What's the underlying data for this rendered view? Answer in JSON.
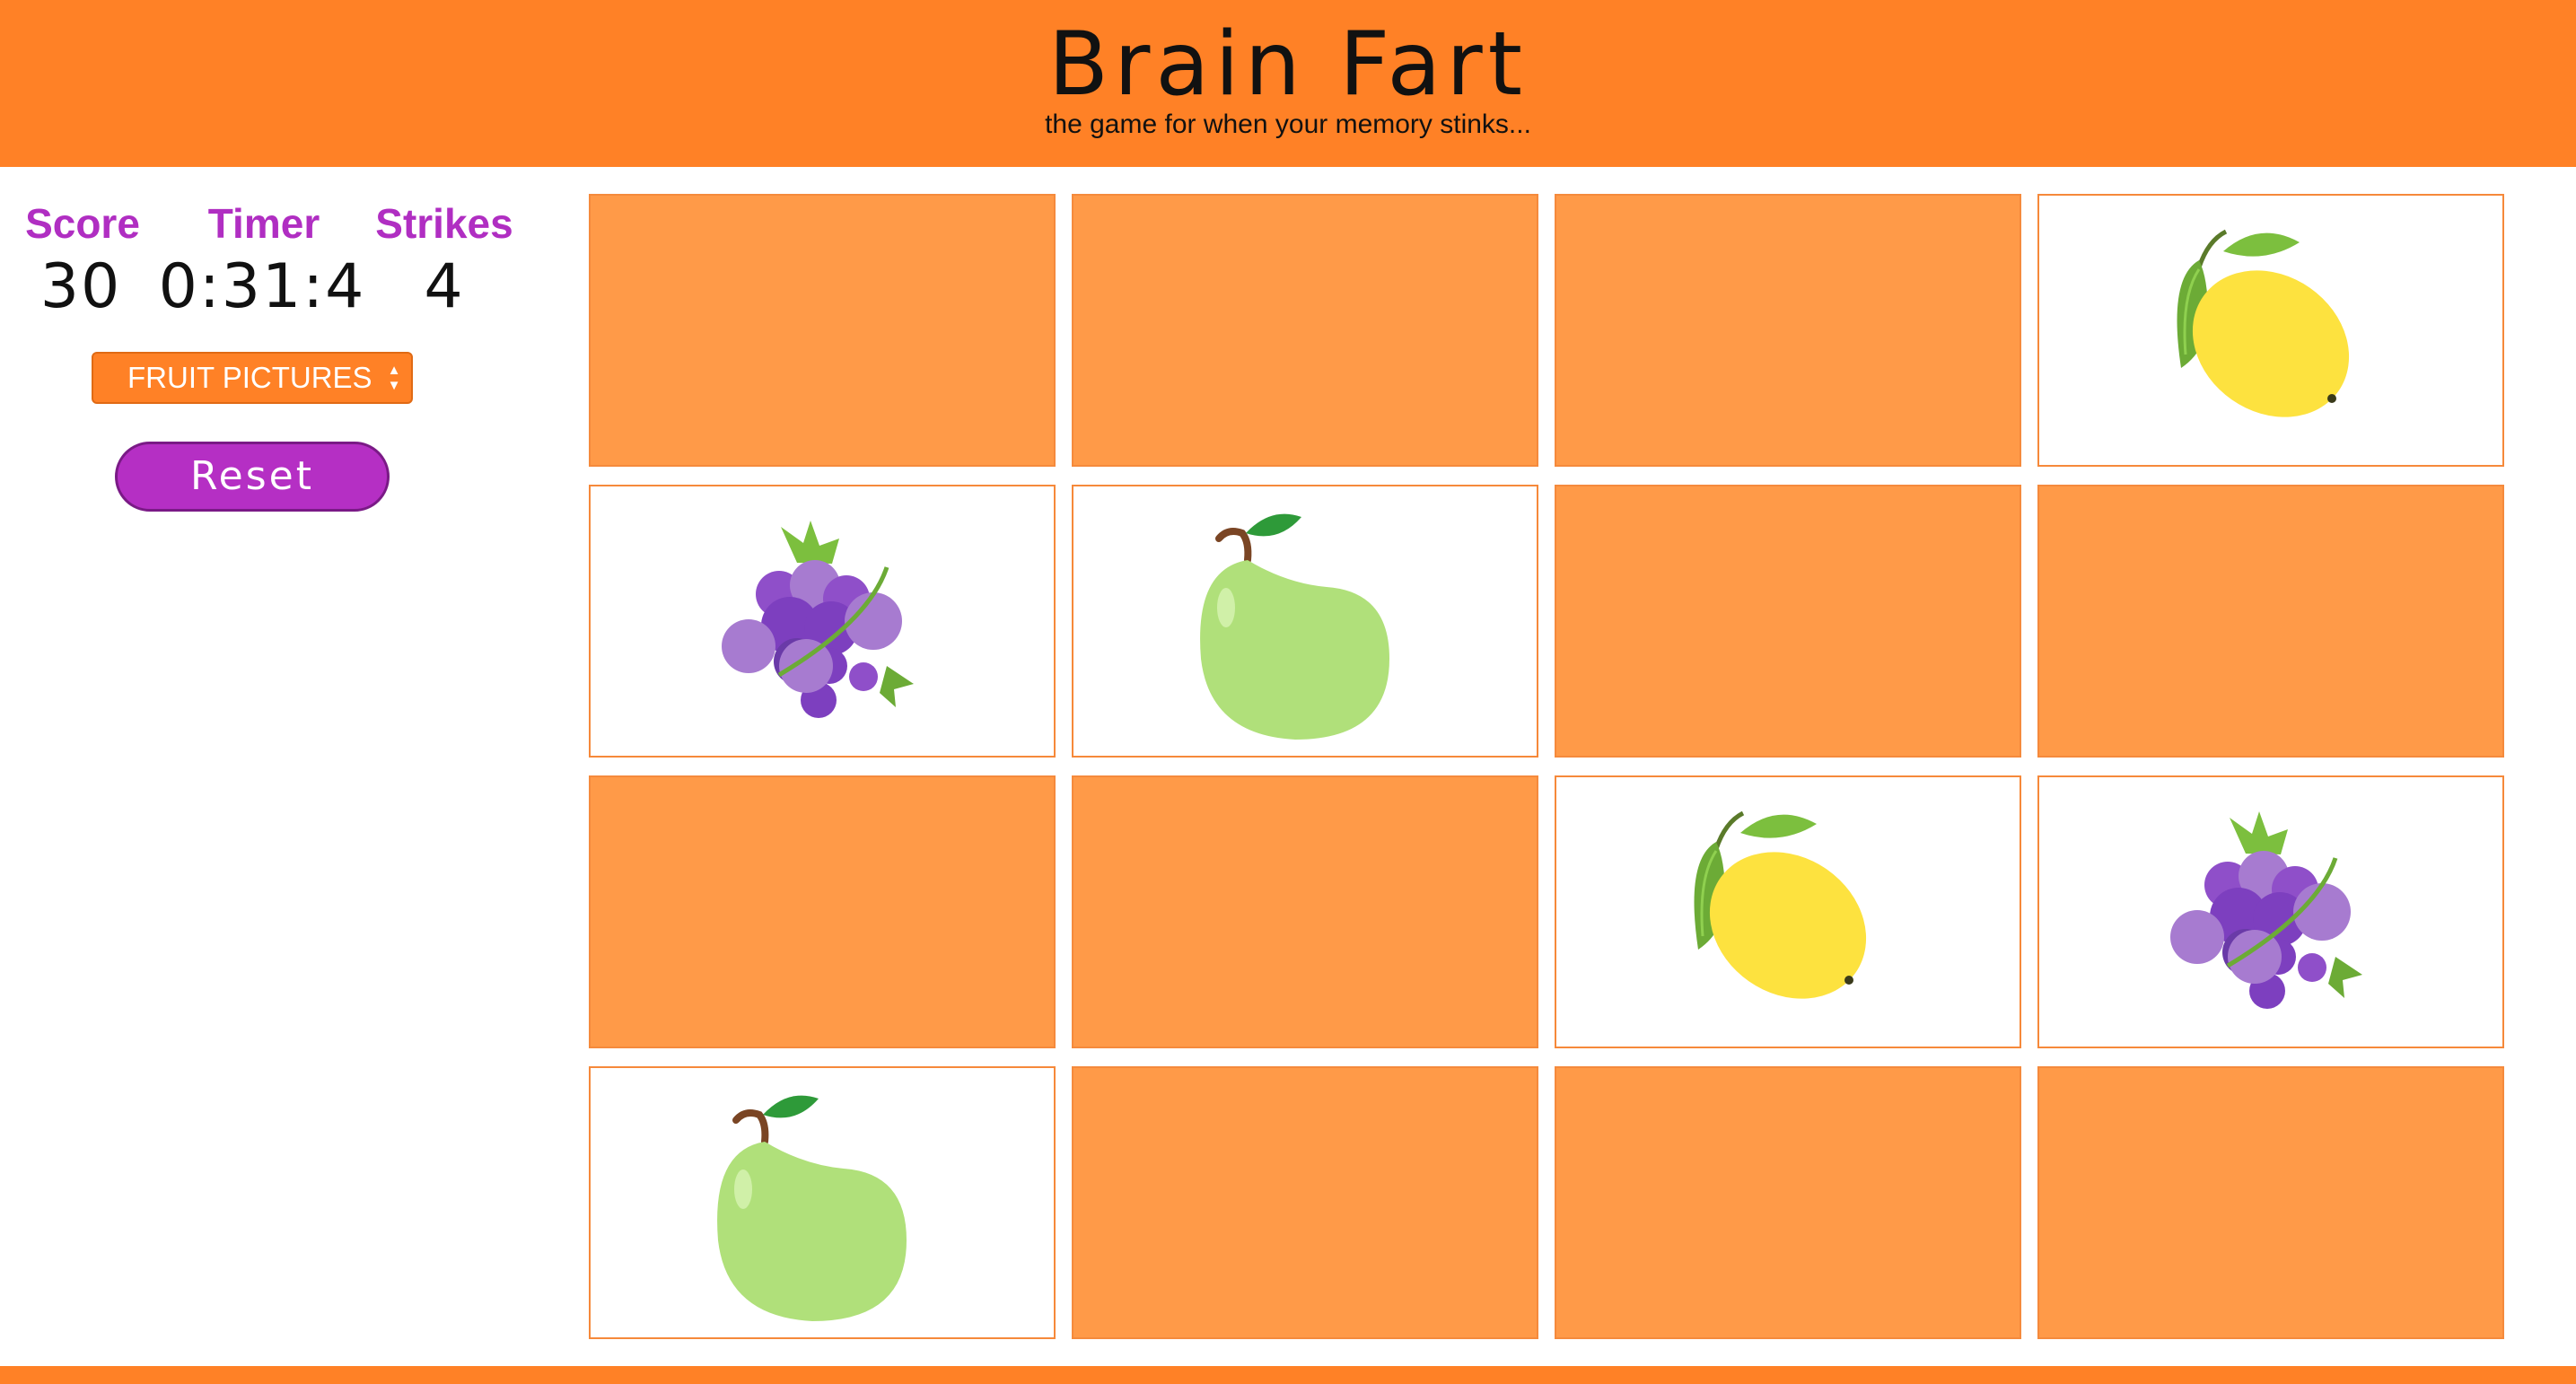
{
  "header": {
    "title": "Brain Fart",
    "subtitle": "the game for when your memory stinks..."
  },
  "stats": {
    "score_label": "Score",
    "score_value": "30",
    "timer_label": "Timer",
    "timer_value": "0:31:4",
    "strikes_label": "Strikes",
    "strikes_value": "4"
  },
  "controls": {
    "deck_select": "FRUIT PICTURES",
    "reset_label": "Reset"
  },
  "board": {
    "rows": 4,
    "columns": 4,
    "cards": [
      {
        "state": "face-down",
        "fruit": ""
      },
      {
        "state": "face-down",
        "fruit": ""
      },
      {
        "state": "face-down",
        "fruit": ""
      },
      {
        "state": "face-up",
        "fruit": "lemon"
      },
      {
        "state": "face-up",
        "fruit": "grapes"
      },
      {
        "state": "face-up",
        "fruit": "pear"
      },
      {
        "state": "face-down",
        "fruit": ""
      },
      {
        "state": "face-down",
        "fruit": ""
      },
      {
        "state": "face-down",
        "fruit": ""
      },
      {
        "state": "face-down",
        "fruit": ""
      },
      {
        "state": "face-up",
        "fruit": "lemon"
      },
      {
        "state": "face-up",
        "fruit": "grapes"
      },
      {
        "state": "face-up",
        "fruit": "pear"
      },
      {
        "state": "face-down",
        "fruit": ""
      },
      {
        "state": "face-down",
        "fruit": ""
      },
      {
        "state": "face-down",
        "fruit": ""
      }
    ]
  },
  "colors": {
    "brand_orange": "#ff8126",
    "card_back": "#ff9a48",
    "accent_purple": "#b52fc4"
  }
}
